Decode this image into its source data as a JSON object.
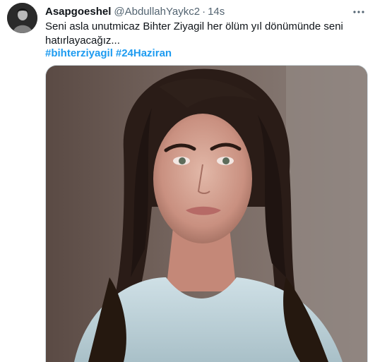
{
  "tweet": {
    "display_name": "Asapgoeshel",
    "handle": "@AbdullahYaykc2",
    "separator": "·",
    "time": "14s",
    "text": "Seni asla unutmicaz Bihter Ziyagil her ölüm yıl dönümünde seni hatırlayacağız...",
    "hashtags": [
      "#bihterziyagil",
      "#24Haziran"
    ]
  },
  "icons": {
    "more": "more-horizontal-icon"
  },
  "colors": {
    "link": "#1d9bf0",
    "secondary_text": "#536471",
    "border": "#cfd9de"
  }
}
